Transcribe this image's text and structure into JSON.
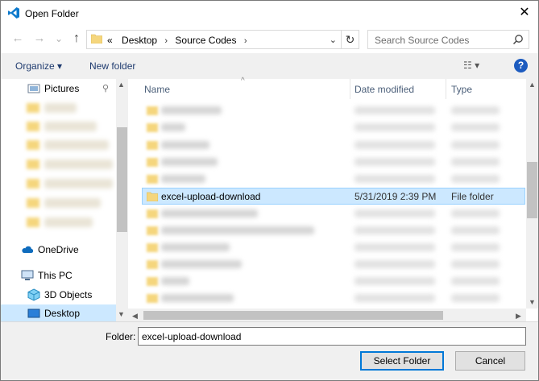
{
  "window": {
    "title": "Open Folder",
    "close_glyph": "✕"
  },
  "nav": {
    "back_glyph": "←",
    "forward_glyph": "→",
    "recent_glyph": "⌄",
    "up_glyph": "↑",
    "address": {
      "prefix": "«",
      "crumbs": [
        "Desktop",
        "Source Codes"
      ],
      "sep": "›",
      "dropdown_glyph": "⌄",
      "refresh_glyph": "↻"
    },
    "search": {
      "placeholder": "Search Source Codes"
    }
  },
  "commands": {
    "organize_label": "Organize ▾",
    "new_folder_label": "New folder",
    "view_glyph": "☷ ▾",
    "help_glyph": "?"
  },
  "nav_pane": {
    "pictures_label": "Pictures",
    "pin_glyph": "📌",
    "onedrive_label": "OneDrive",
    "this_pc_label": "This PC",
    "objects3d_label": "3D Objects",
    "desktop_label": "Desktop"
  },
  "file_list": {
    "columns": {
      "name": "Name",
      "date": "Date modified",
      "type": "Type"
    },
    "sort_glyph": "^",
    "selected_row": {
      "name": "excel-upload-download",
      "date": "5/31/2019 2:39 PM",
      "type": "File folder"
    }
  },
  "bottom": {
    "folder_label": "Folder:",
    "folder_value": "excel-upload-download",
    "select_button": "Select Folder",
    "cancel_button": "Cancel"
  },
  "colors": {
    "accent": "#0078d7",
    "selection": "#cce8ff",
    "folder": "#f5d67d"
  }
}
